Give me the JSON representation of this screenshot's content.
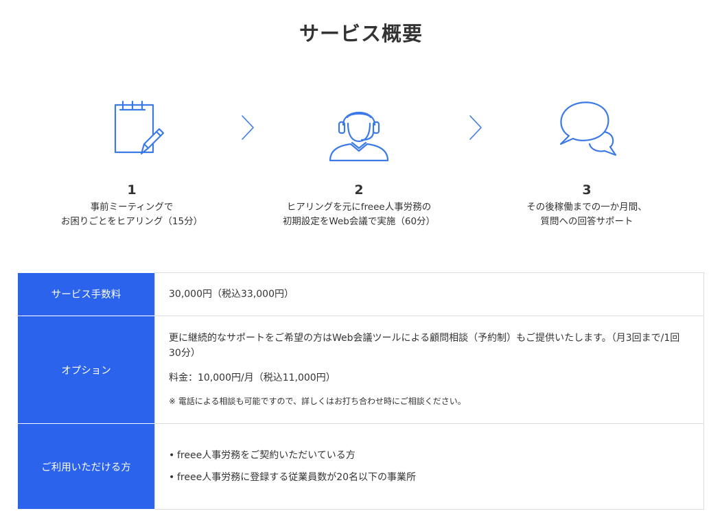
{
  "page": {
    "title": "サービス概要"
  },
  "colors": {
    "accent": "#2b63ed",
    "icon_stroke": "#3b7ae6",
    "text": "#333333",
    "border": "#dddddd"
  },
  "steps": [
    {
      "number": "1",
      "icon": "notepad-pencil-icon",
      "lines": [
        "事前ミーティングで",
        "お困りごとをヒアリング（15分）"
      ]
    },
    {
      "number": "2",
      "icon": "headset-operator-icon",
      "lines": [
        "ヒアリングを元にfreee人事労務の",
        "初期設定をWeb会議で実施（60分）"
      ]
    },
    {
      "number": "3",
      "icon": "speech-bubbles-icon",
      "lines": [
        "その後稼働までの一か月間、",
        "質問への回答サポート"
      ]
    }
  ],
  "table": {
    "fee": {
      "label": "サービス手数料",
      "value": "30,000円（税込33,000円）"
    },
    "option": {
      "label": "オプション",
      "description": "更に継続的なサポートをご希望の方はWeb会議ツールによる顧問相談（予約制）もご提供いたします。（月3回まで/1回30分）",
      "price": "料金：10,000円/月（税込11,000円）",
      "note": "※ 電話による相談も可能ですので、詳しくはお打ち合わせ時にご相談ください。"
    },
    "target": {
      "label": "ご利用いただける方",
      "items": [
        "freee人事労務をご契約いただいている方",
        "freee人事労務に登録する従業員数が20名以下の事業所"
      ]
    }
  }
}
